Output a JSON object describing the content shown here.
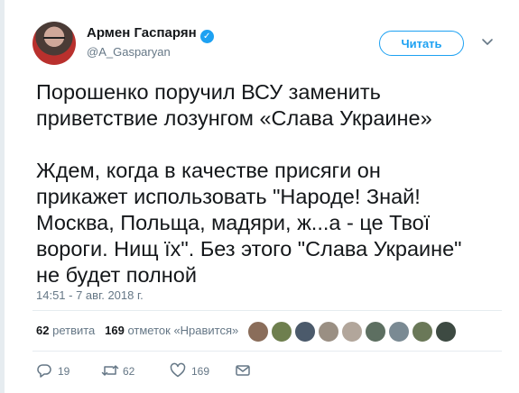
{
  "user": {
    "display_name": "Армен Гаспарян",
    "handle": "@A_Gasparyan",
    "verified": true
  },
  "follow_button": "Читать",
  "tweet": {
    "text": "Порошенко поручил ВСУ заменить\nприветствие лозунгом «Слава Украине»\n\nЖдем, когда в качестве присяги он\nприкажет использовать \"Народе! Знай!\nМосква, Польща, мадяри, ж...а - це Твої\nвороги. Нищ їх\". Без этого \"Слава Украине\"\nне будет полной",
    "timestamp": "14:51 - 7 авг. 2018 г."
  },
  "stats": {
    "retweets_count": "62",
    "retweets_label": "ретвита",
    "likes_count": "169",
    "likes_label": "отметок «Нравится»"
  },
  "liker_avatars": 9,
  "actions": {
    "reply_count": "19",
    "retweet_count": "62",
    "like_count": "169"
  },
  "icons": [
    "verified-badge-icon",
    "chevron-down-icon",
    "reply-icon",
    "retweet-icon",
    "like-icon",
    "direct-message-icon"
  ],
  "colors": {
    "accent": "#1da1f2",
    "text": "#14171a",
    "muted": "#657786",
    "divider": "#e6ecf0"
  }
}
